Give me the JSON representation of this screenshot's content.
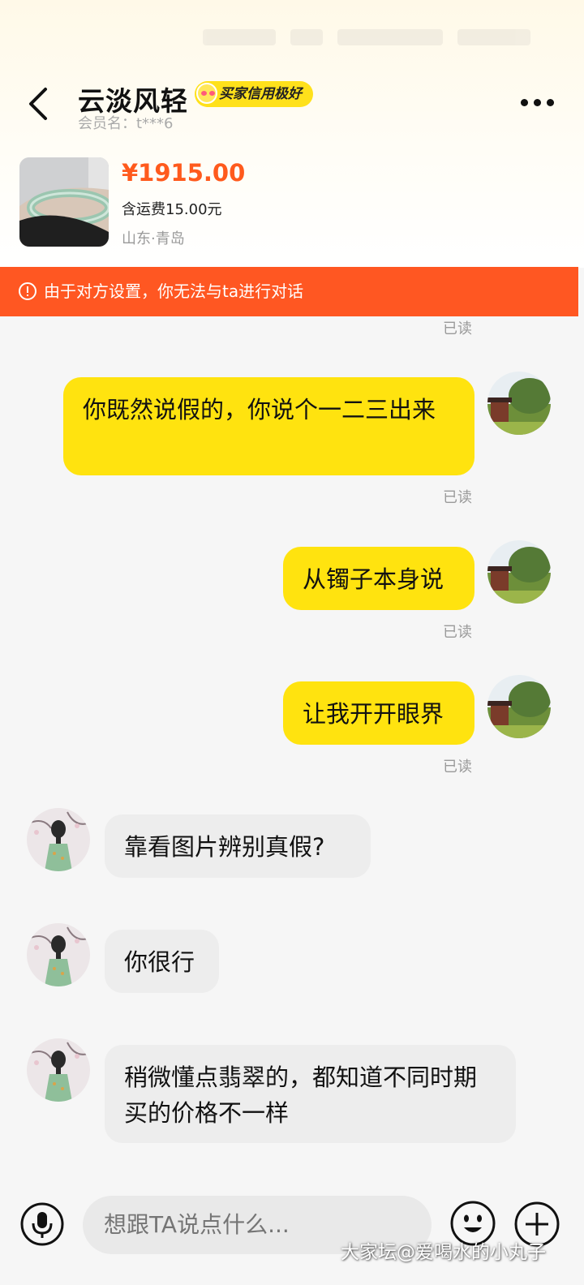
{
  "header": {
    "contact_name": "云淡风轻",
    "credit_badge": "买家信用极好",
    "member_label": "会员名：t***6",
    "back_icon": "chevron-left-icon",
    "more_icon": "more-dots-icon"
  },
  "product": {
    "price": "¥1915.00",
    "shipping": "含运费15.00元",
    "location": "山东·青岛",
    "image": "jade-bangle-photo"
  },
  "alert": {
    "text": "由于对方设置，你无法与ta进行对话",
    "icon": "exclamation-circle-icon"
  },
  "messages": [
    {
      "from": "me",
      "text": "你既然说假的，你说个一二三出来",
      "status": "已读"
    },
    {
      "from": "me",
      "text": "从镯子本身说",
      "status": "已读"
    },
    {
      "from": "me",
      "text": "让我开开眼界",
      "status": "已读"
    },
    {
      "from": "other",
      "text": "靠看图片辨别真假?"
    },
    {
      "from": "other",
      "text": "你很行"
    },
    {
      "from": "other",
      "text": "稍微懂点翡翠的，都知道不同时期买的价格不一样"
    }
  ],
  "read_status_top": "已读",
  "composer": {
    "placeholder": "想跟TA说点什么...",
    "mic_icon": "microphone-icon",
    "emoji_icon": "smiley-icon",
    "plus_icon": "plus-circle-icon"
  },
  "watermark": "大家坛@爱喝水的小丸子",
  "colors": {
    "accent_yellow": "#ffe30f",
    "alert_orange": "#ff5722",
    "price_orange": "#ff5a1d",
    "other_bubble": "#ededed"
  }
}
